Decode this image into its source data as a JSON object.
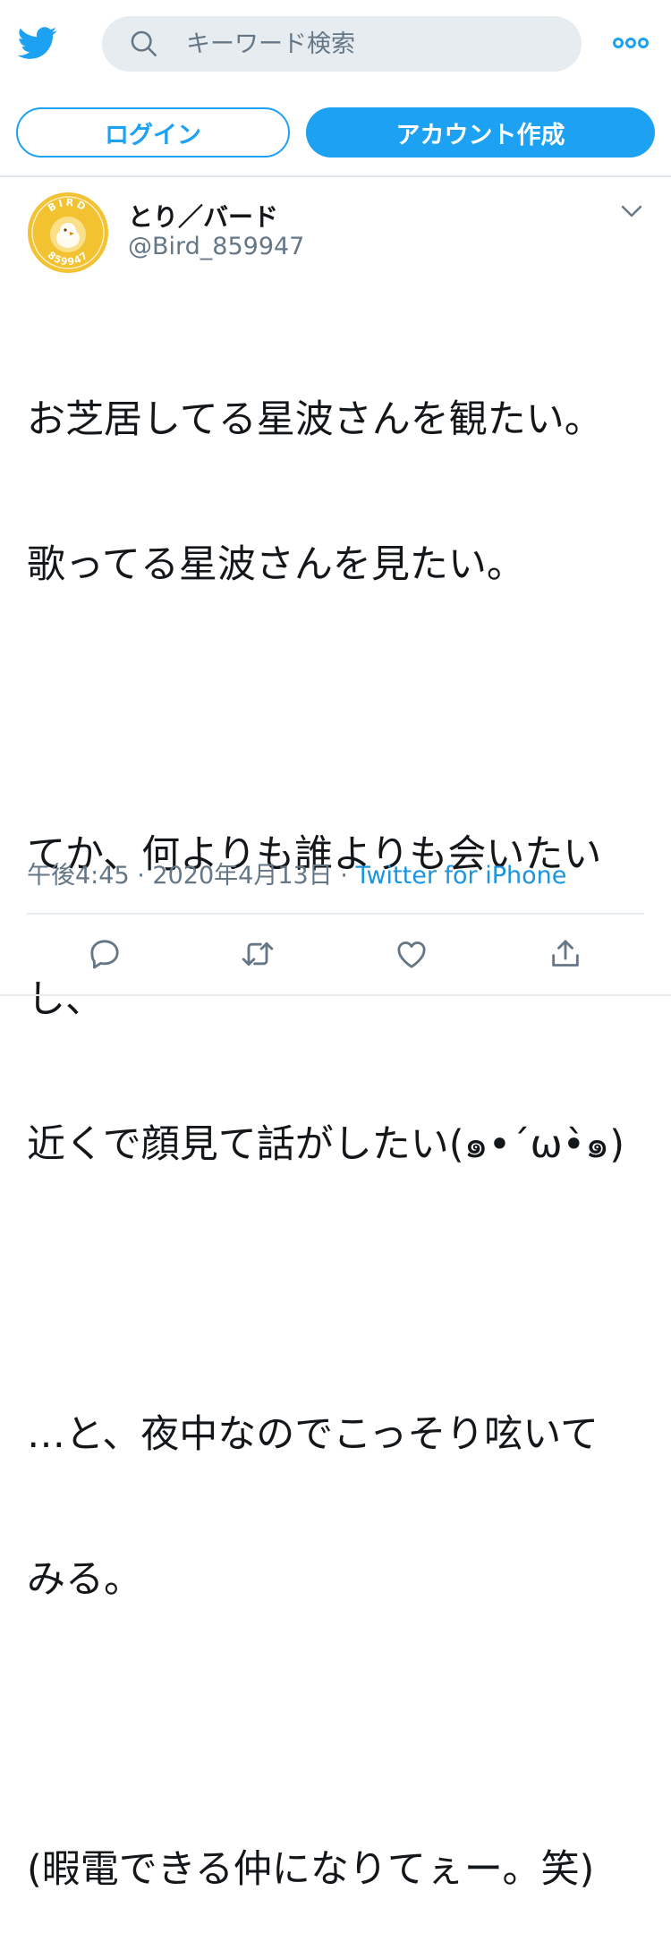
{
  "header": {
    "logo_icon": "twitter-bird-icon",
    "search": {
      "placeholder": "キーワード検索",
      "value": "",
      "icon": "search-icon"
    },
    "more_icon": "more-dots-icon"
  },
  "auth": {
    "login_label": "ログイン",
    "signup_label": "アカウント作成"
  },
  "tweet": {
    "author": {
      "display_name": "とり／バード",
      "handle": "@Bird_859947",
      "avatar_text_top": "BIRD",
      "avatar_text_bottom": "859947"
    },
    "menu_icon": "chevron-down-icon",
    "lines": [
      "お芝居してる星波さんを観たい。",
      "歌ってる星波さんを見たい。",
      "",
      "てか、何よりも誰よりも会いたい",
      "し、",
      "近くで顔見て話がしたい(๑•´ω•̀๑)",
      "",
      "…と、夜中なのでこっそり呟いて",
      "みる。",
      "",
      "(暇電できる仲になりてぇー。笑)"
    ],
    "time": "午後4:45",
    "date": "2020年4月13日",
    "separator": "·",
    "source": "Twitter for iPhone",
    "actions": [
      "reply-icon",
      "retweet-icon",
      "like-icon",
      "share-icon"
    ]
  },
  "colors": {
    "brand": "#1da1f2",
    "text_primary": "#14171a",
    "text_secondary": "#657786",
    "link": "#1b95e0",
    "search_bg": "#e6ecf0",
    "avatar_gold": "#f2c230"
  }
}
